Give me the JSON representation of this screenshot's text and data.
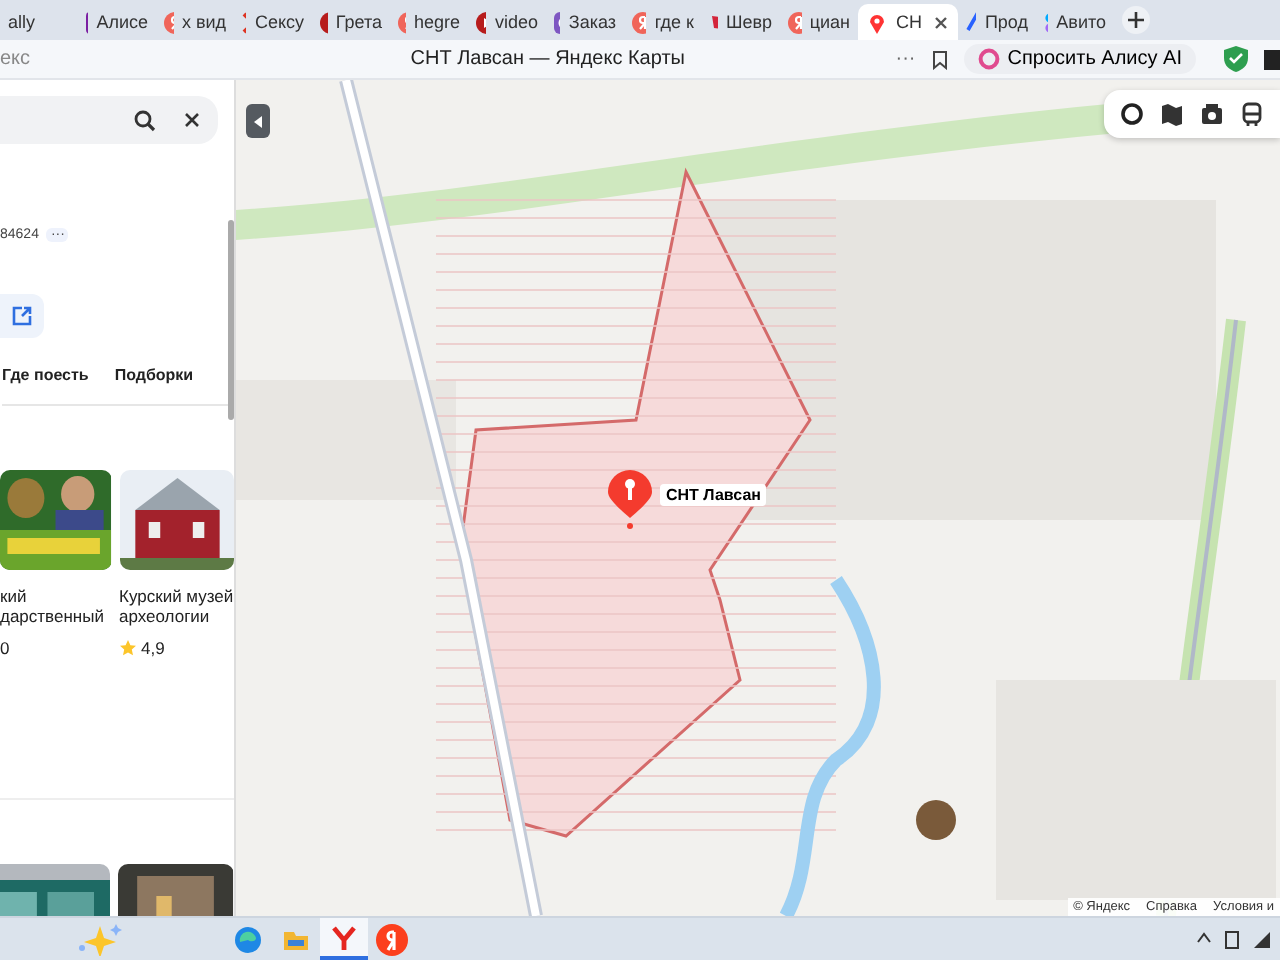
{
  "browser_tabs": [
    {
      "label": "ally",
      "selected": false
    },
    {
      "label": "Алисе",
      "selected": false
    },
    {
      "label": "х вид",
      "selected": false
    },
    {
      "label": "Сексу",
      "selected": false
    },
    {
      "label": "Грета",
      "selected": false
    },
    {
      "label": "hegre",
      "selected": false
    },
    {
      "label": "video",
      "selected": false
    },
    {
      "label": "Заказ",
      "selected": false
    },
    {
      "label": "где к",
      "selected": false
    },
    {
      "label": "Шевр",
      "selected": false
    },
    {
      "label": "циан",
      "selected": false
    },
    {
      "label": "СН",
      "selected": true
    },
    {
      "label": "Прод",
      "selected": false
    },
    {
      "label": "Авито",
      "selected": false
    }
  ],
  "address_bar": {
    "url": "екс",
    "title": "СНТ Лавсан — Яндекс Карты",
    "menu": "···",
    "alice_button": "Спросить Алису AI"
  },
  "side_panel": {
    "phone": "84624",
    "phone_more": "···",
    "tabs": [
      {
        "label": "Где поесть",
        "selected": false
      },
      {
        "label": "Подборки",
        "selected": false
      }
    ],
    "cards": [
      {
        "title": "кий дарственный",
        "rating": "0",
        "star": false
      },
      {
        "title": "Курский музей археологии",
        "rating": "4,9",
        "star": true
      }
    ]
  },
  "map": {
    "pin_label": "СНТ Лавсан",
    "footer": [
      "© Яндекс",
      "Справка",
      "Условия и"
    ]
  },
  "taskbar": {
    "apps": [
      {
        "kind": "edge",
        "selected": false
      },
      {
        "kind": "files",
        "selected": false
      },
      {
        "kind": "browser",
        "selected": true
      },
      {
        "kind": "yandex",
        "selected": false
      }
    ]
  }
}
